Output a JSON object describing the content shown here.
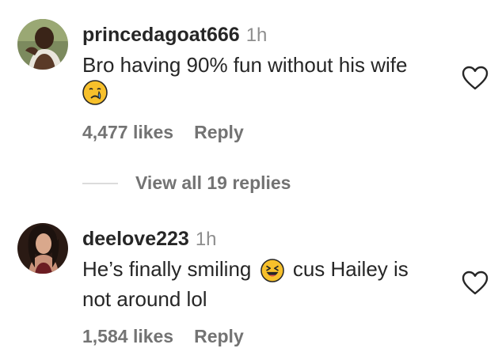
{
  "comments": [
    {
      "username": "princedagoat666",
      "time": "1h",
      "text_line1": "Bro having 90% fun without his wife",
      "emoji": "crying-face",
      "likes": "4,477 likes",
      "reply_label": "Reply",
      "avatar": "avatar-man-outdoor",
      "like_icon": "heart-outline-icon"
    },
    {
      "username": "deelove223",
      "time": "1h",
      "text_before_emoji": "He’s finally smiling",
      "emoji": "squinting-laughing-face",
      "text_after_emoji": "cus Hailey is",
      "text_line2": "not around lol",
      "likes": "1,584 likes",
      "reply_label": "Reply",
      "avatar": "avatar-woman-portrait",
      "like_icon": "heart-outline-icon"
    }
  ],
  "view_replies": {
    "label": "View all 19 replies"
  },
  "colors": {
    "text": "#262626",
    "muted": "#737373",
    "time": "#8e8e8e",
    "divider": "#dbdbdb",
    "emoji_yellow": "#f7c02b"
  }
}
